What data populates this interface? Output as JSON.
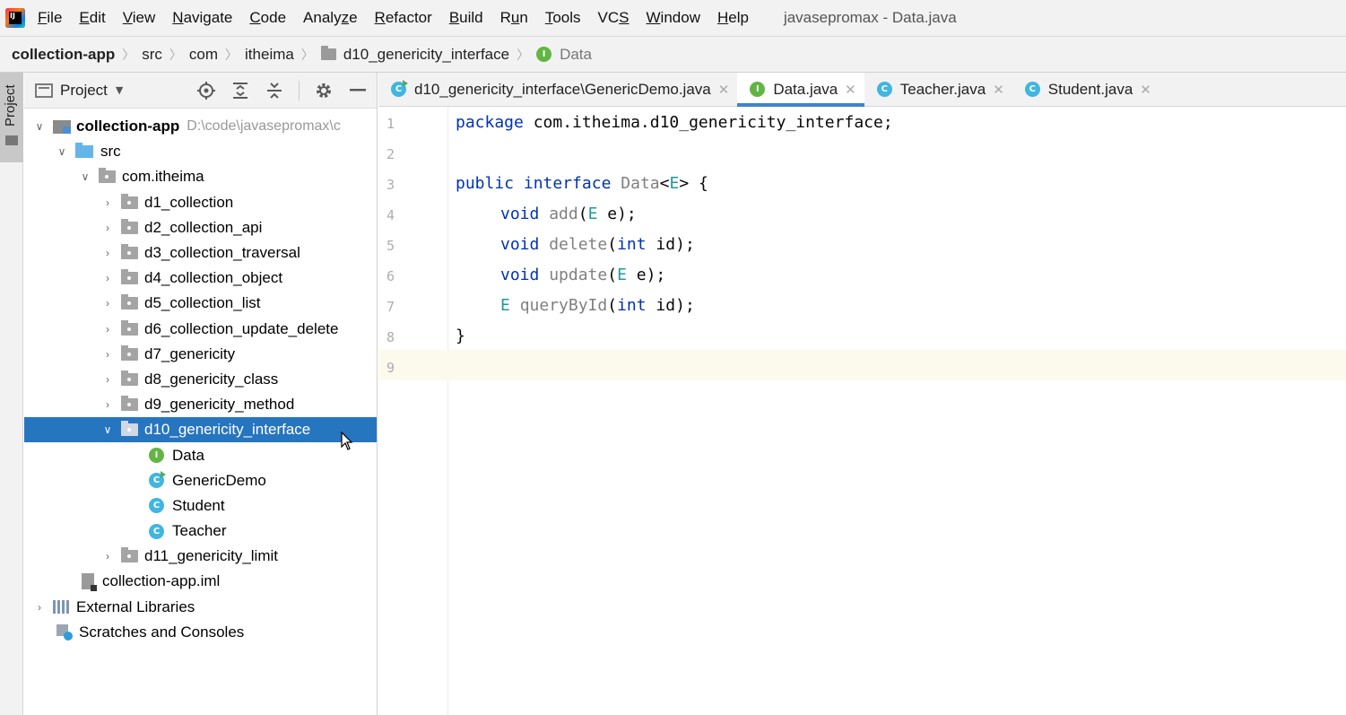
{
  "menu": {
    "items": [
      {
        "mnemonic": "F",
        "rest": "ile"
      },
      {
        "mnemonic": "E",
        "rest": "dit"
      },
      {
        "mnemonic": "V",
        "rest": "iew"
      },
      {
        "mnemonic": "N",
        "rest": "avigate"
      },
      {
        "mnemonic": "C",
        "rest": "ode"
      },
      {
        "prefix": "Analy",
        "mnemonic": "z",
        "rest": "e"
      },
      {
        "mnemonic": "R",
        "rest": "efactor"
      },
      {
        "mnemonic": "B",
        "rest": "uild"
      },
      {
        "prefix": "R",
        "mnemonic": "u",
        "rest": "n"
      },
      {
        "mnemonic": "T",
        "rest": "ools"
      },
      {
        "prefix": "VC",
        "mnemonic": "S",
        "rest": ""
      },
      {
        "mnemonic": "W",
        "rest": "indow"
      },
      {
        "mnemonic": "H",
        "rest": "elp"
      }
    ],
    "window_title": "javasepromax - Data.java"
  },
  "breadcrumb": {
    "items": [
      "collection-app",
      "src",
      "com",
      "itheima",
      "d10_genericity_interface",
      "Data"
    ]
  },
  "side_strip": {
    "label": "Project"
  },
  "project_panel": {
    "title": "Project",
    "tree": {
      "root_label": "collection-app",
      "root_path": "D:\\code\\javasepromax\\c",
      "src": "src",
      "package": "com.itheima",
      "folders": [
        "d1_collection",
        "d2_collection_api",
        "d3_collection_traversal",
        "d4_collection_object",
        "d5_collection_list",
        "d6_collection_update_delete",
        "d7_genericity",
        "d8_genericity_class",
        "d9_genericity_method",
        "d10_genericity_interface"
      ],
      "children": [
        "Data",
        "GenericDemo",
        "Student",
        "Teacher"
      ],
      "after_folder": "d11_genericity_limit",
      "iml": "collection-app.iml",
      "external_libraries": "External Libraries",
      "scratches": "Scratches and Consoles"
    }
  },
  "tabs": [
    {
      "label": "d10_genericity_interface\\GenericDemo.java",
      "icon": "class-run-icon",
      "active": false
    },
    {
      "label": "Data.java",
      "icon": "interface-icon",
      "active": true
    },
    {
      "label": "Teacher.java",
      "icon": "class-icon",
      "active": false
    },
    {
      "label": "Student.java",
      "icon": "class-icon",
      "active": false
    }
  ],
  "editor": {
    "line_numbers": [
      "1",
      "2",
      "3",
      "4",
      "5",
      "6",
      "7",
      "8",
      "9"
    ],
    "code": {
      "l1_kw": "package",
      "l1_rest": " com.itheima.d10_genericity_interface;",
      "l3_kw1": "public",
      "l3_kw2": "interface",
      "l3_name": "Data",
      "l3_lt": "<",
      "l3_tp": "E",
      "l3_rest": "> {",
      "l4_kw": "void",
      "l4_m": "add",
      "l4_open": "(",
      "l4_tp": "E",
      "l4_rest": " e);",
      "l5_kw": "void",
      "l5_m": "delete",
      "l5_open": "(",
      "l5_kw2": "int",
      "l5_rest": " id);",
      "l6_kw": "void",
      "l6_m": "update",
      "l6_open": "(",
      "l6_tp": "E",
      "l6_rest": " e);",
      "l7_tp": "E",
      "l7_m": "queryById",
      "l7_open": "(",
      "l7_kw": "int",
      "l7_rest": " id);",
      "l8": "}"
    }
  },
  "icons": {
    "app": "intellij-logo-icon",
    "interface_badge": "I",
    "class_badge": "C"
  },
  "colors": {
    "selection": "#2675bf",
    "keyword": "#0033b3",
    "type_param": "#20999d",
    "interface_badge": "#62b543",
    "class_badge": "#40b6e0"
  }
}
